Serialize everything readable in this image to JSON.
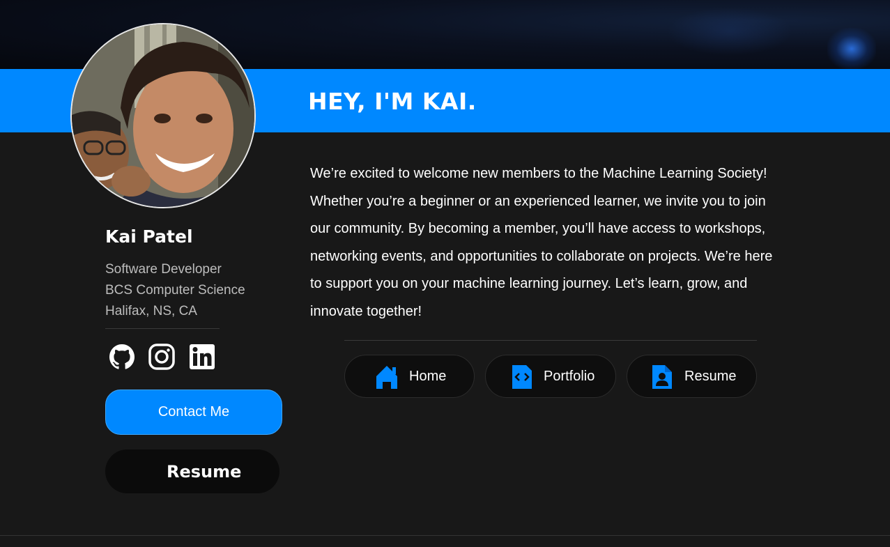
{
  "hero": {
    "headline": "HEY, I'M KAI."
  },
  "profile": {
    "avatar_icon": "profile-photo",
    "name": "Kai Patel",
    "role": "Software Developer",
    "education": "BCS Computer Science",
    "location": "Halifax, NS, CA",
    "socials": [
      {
        "icon": "github-icon"
      },
      {
        "icon": "instagram-icon"
      },
      {
        "icon": "linkedin-icon"
      }
    ],
    "contact_label": "Contact Me",
    "resume_label": "Resume"
  },
  "intro": {
    "text": "We’re excited to welcome new members to the Machine Learning Society! Whether you’re a beginner or an experienced learner, we invite you to join our community. By becoming a member, you’ll have access to workshops, networking events, and opportunities to collaborate on projects. We’re here to support you on your machine learning journey. Let’s learn, grow, and innovate together!"
  },
  "nav": [
    {
      "label": "Home",
      "icon": "home-icon"
    },
    {
      "label": "Portfolio",
      "icon": "code-file-icon"
    },
    {
      "label": "Resume",
      "icon": "resume-file-icon"
    }
  ],
  "colors": {
    "accent": "#0088ff",
    "background": "#181818",
    "button_dark": "#0e0e0e"
  }
}
